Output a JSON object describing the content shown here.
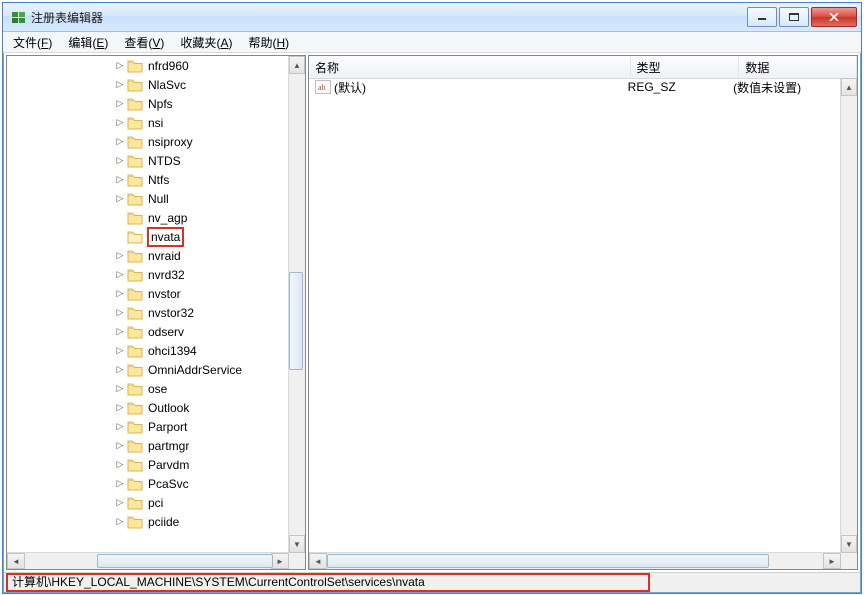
{
  "window": {
    "title": "注册表编辑器"
  },
  "menubar": {
    "file": {
      "label": "文件",
      "key": "F"
    },
    "edit": {
      "label": "编辑",
      "key": "E"
    },
    "view": {
      "label": "查看",
      "key": "V"
    },
    "fav": {
      "label": "收藏夹",
      "key": "A"
    },
    "help": {
      "label": "帮助",
      "key": "H"
    }
  },
  "tree": {
    "indent_base": 108,
    "items": [
      {
        "label": "nfrd960",
        "expandable": true,
        "selected": false
      },
      {
        "label": "NlaSvc",
        "expandable": true,
        "selected": false
      },
      {
        "label": "Npfs",
        "expandable": true,
        "selected": false
      },
      {
        "label": "nsi",
        "expandable": true,
        "selected": false
      },
      {
        "label": "nsiproxy",
        "expandable": true,
        "selected": false
      },
      {
        "label": "NTDS",
        "expandable": true,
        "selected": false
      },
      {
        "label": "Ntfs",
        "expandable": true,
        "selected": false
      },
      {
        "label": "Null",
        "expandable": true,
        "selected": false
      },
      {
        "label": "nv_agp",
        "expandable": false,
        "selected": false
      },
      {
        "label": "nvata",
        "expandable": false,
        "selected": true
      },
      {
        "label": "nvraid",
        "expandable": true,
        "selected": false
      },
      {
        "label": "nvrd32",
        "expandable": true,
        "selected": false
      },
      {
        "label": "nvstor",
        "expandable": true,
        "selected": false
      },
      {
        "label": "nvstor32",
        "expandable": true,
        "selected": false
      },
      {
        "label": "odserv",
        "expandable": true,
        "selected": false
      },
      {
        "label": "ohci1394",
        "expandable": true,
        "selected": false
      },
      {
        "label": "OmniAddrService",
        "expandable": true,
        "selected": false
      },
      {
        "label": "ose",
        "expandable": true,
        "selected": false
      },
      {
        "label": "Outlook",
        "expandable": true,
        "selected": false
      },
      {
        "label": "Parport",
        "expandable": true,
        "selected": false
      },
      {
        "label": "partmgr",
        "expandable": true,
        "selected": false
      },
      {
        "label": "Parvdm",
        "expandable": true,
        "selected": false
      },
      {
        "label": "PcaSvc",
        "expandable": true,
        "selected": false
      },
      {
        "label": "pci",
        "expandable": true,
        "selected": false
      },
      {
        "label": "pciide",
        "expandable": true,
        "selected": false
      }
    ]
  },
  "list": {
    "columns": {
      "name": "名称",
      "type": "类型",
      "data": "数据"
    },
    "col_widths": {
      "name": 354,
      "type": 110,
      "data": 120
    },
    "rows": [
      {
        "name": "(默认)",
        "type": "REG_SZ",
        "data": "(数值未设置)"
      }
    ]
  },
  "statusbar": {
    "path": "计算机\\HKEY_LOCAL_MACHINE\\SYSTEM\\CurrentControlSet\\services\\nvata"
  },
  "highlights": {
    "tree_highlight_color": "#d93025",
    "status_highlight_color": "#d93025"
  }
}
